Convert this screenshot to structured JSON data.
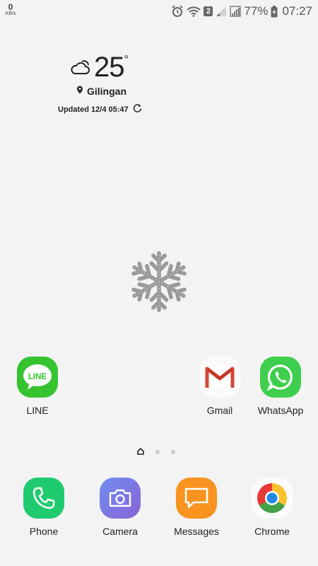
{
  "status_bar": {
    "network_speed": "0",
    "network_unit": "KB/s",
    "sim_slot": "2",
    "battery_percent": "77%",
    "time": "07:27"
  },
  "weather": {
    "temperature": "25",
    "degree_symbol": "°",
    "location": "Gilingan",
    "updated": "Updated 12/4 05:47"
  },
  "home_apps": [
    {
      "label": "LINE",
      "icon": "line-icon",
      "tile_text": "LINE"
    },
    {
      "label": "Gmail",
      "icon": "gmail-icon"
    },
    {
      "label": "WhatsApp",
      "icon": "whatsapp-icon"
    }
  ],
  "dock": [
    {
      "label": "Phone",
      "icon": "phone-icon"
    },
    {
      "label": "Camera",
      "icon": "camera-icon"
    },
    {
      "label": "Messages",
      "icon": "messages-icon"
    },
    {
      "label": "Chrome",
      "icon": "chrome-icon"
    }
  ],
  "page_indicator": {
    "count": 3,
    "current": 1
  }
}
